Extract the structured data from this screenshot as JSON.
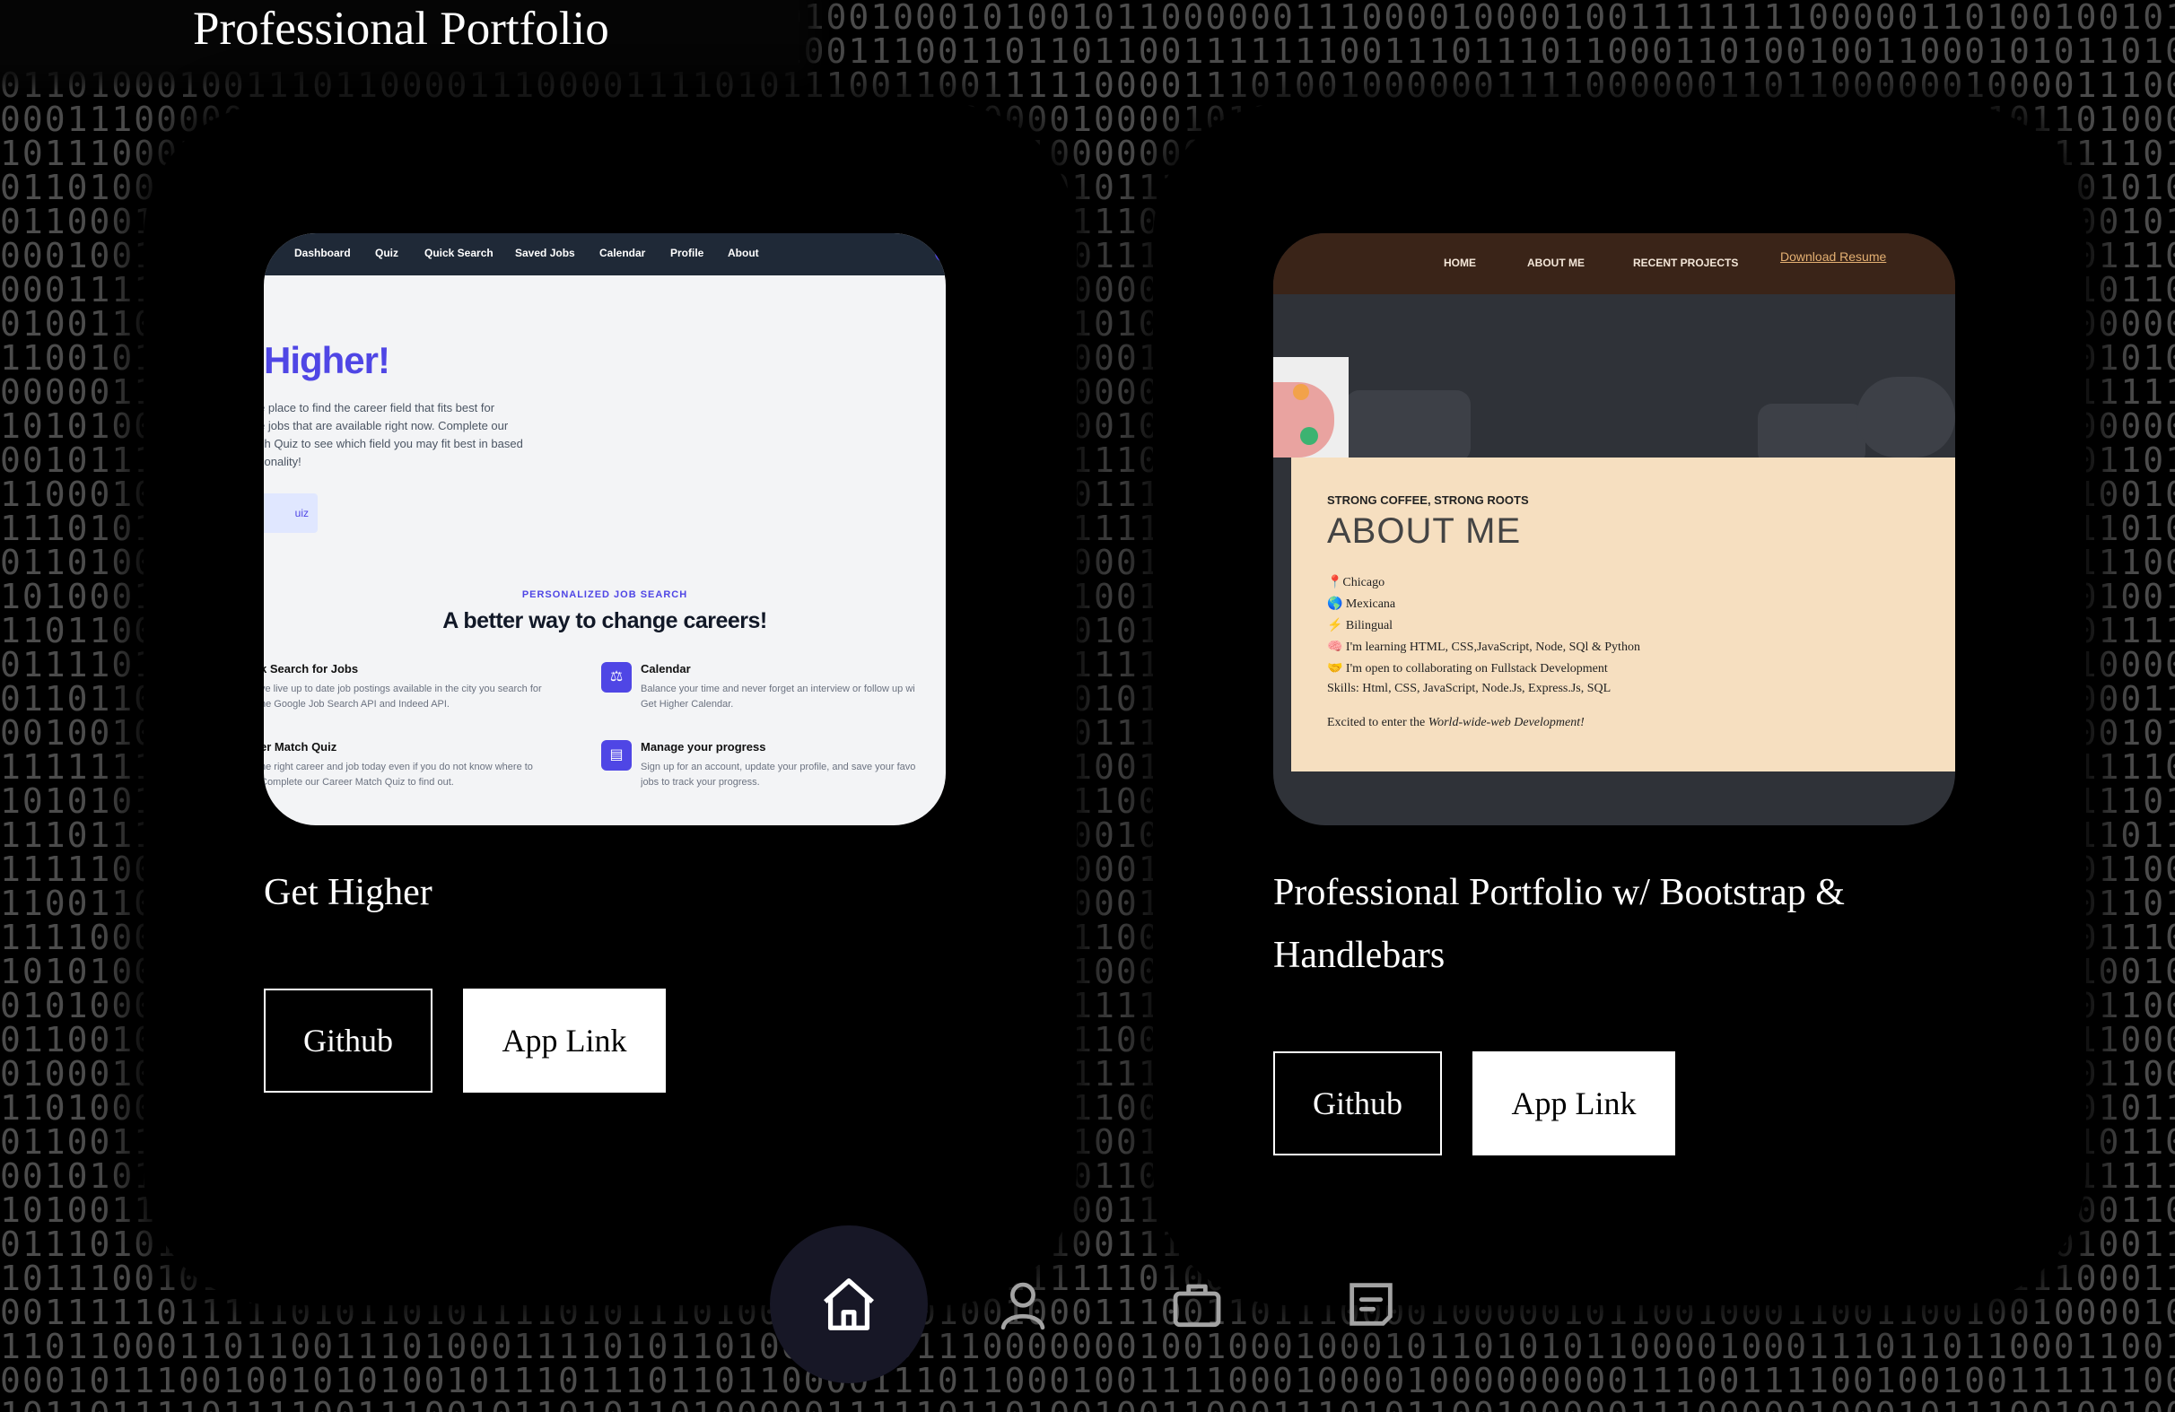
{
  "header": {
    "title": "Professional Portfolio"
  },
  "projects": [
    {
      "title": "Get Higher",
      "github_label": "Github",
      "app_link_label": "App Link",
      "screenshot": {
        "nav": [
          "Dashboard",
          "Quiz",
          "Quick Search",
          "Saved Jobs",
          "Calendar",
          "Profile",
          "About"
        ],
        "hero": "Higher!",
        "sub_lines": [
          "e place to find the career field that fits best for",
          "e jobs that are available right now. Complete our",
          "ch Quiz to see which field you may fit best in based",
          "sonality!"
        ],
        "quiz_btn": "uiz",
        "eyebrow": "PERSONALIZED JOB SEARCH",
        "headline": "A better way to change careers!",
        "features": [
          {
            "title": "k Search for Jobs",
            "lines": [
              "ve live up to date job postings available in the city you search for",
              "he Google Job Search API and Indeed API."
            ]
          },
          {
            "title": "Calendar",
            "lines": [
              "Balance your time and never forget an interview or follow up wi",
              "Get Higher Calendar."
            ]
          },
          {
            "title": "er Match Quiz",
            "lines": [
              "he right career and job today even if you do not know where to",
              "Complete our Career Match Quiz to find out."
            ]
          },
          {
            "title": "Manage your progress",
            "lines": [
              "Sign up for an account, update your profile, and save your favo",
              "jobs to track your progress."
            ]
          }
        ]
      }
    },
    {
      "title_line1": "Professional Portfolio w/ Bootstrap &",
      "title_line2": "Handlebars",
      "github_label": "Github",
      "app_link_label": "App Link",
      "screenshot": {
        "nav": [
          "HOME",
          "ABOUT ME",
          "RECENT PROJECTS"
        ],
        "download": "Download Resume",
        "eyebrow": "STRONG COFFEE, STRONG ROOTS",
        "headline": "ABOUT ME",
        "list": [
          "📍Chicago",
          "🌎 Mexicana",
          "⚡ Bilingual",
          "🧠 I'm learning HTML, CSS,JavaScript, Node, SQl & Python",
          "🤝 I'm open to collaborating on Fullstack Development"
        ],
        "skills": "Skills: Html, CSS, JavaScript, Node.Js, Express.Js, SQL",
        "excited_prefix": "Excited to enter the ",
        "excited_em": "World-wide-web Development!"
      }
    }
  ],
  "bottom_nav": [
    {
      "icon": "home-icon",
      "active": true
    },
    {
      "icon": "user-icon",
      "active": false
    },
    {
      "icon": "briefcase-icon",
      "active": false
    },
    {
      "icon": "blog-icon",
      "active": false
    }
  ],
  "colors": {
    "background": "#000000",
    "accent": "#4f46e5",
    "nav_active": "#171726",
    "icon": "#a3a3a3",
    "icon_active": "#ffffff"
  }
}
